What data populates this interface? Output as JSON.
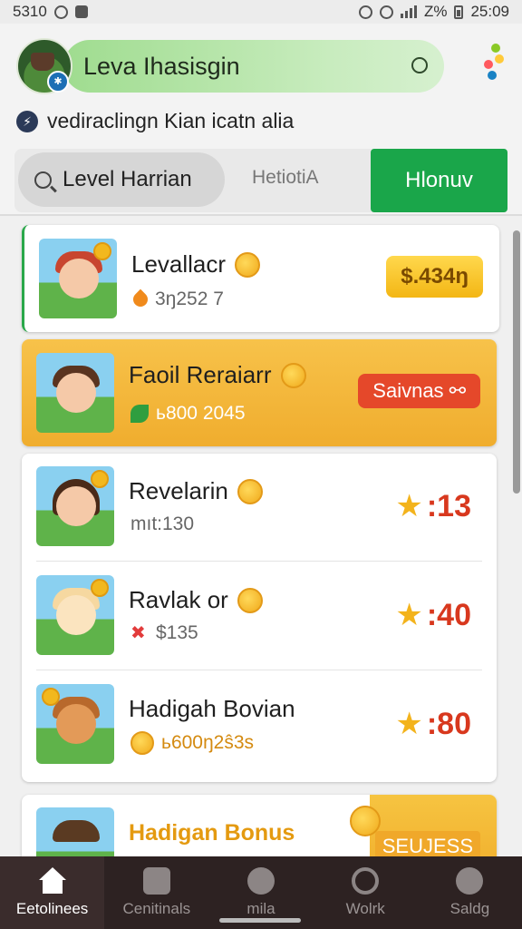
{
  "status_bar": {
    "left_text": "5310",
    "right_text": "Z%",
    "time": "25:09"
  },
  "header": {
    "title": "Leva Ihasisgin",
    "subtitle": "vediraclingn Kian icatn alia"
  },
  "tabs": {
    "search_label": "Level Harrian",
    "middle_label": "HetiotiA",
    "active_label": "Hlonuv"
  },
  "cards": [
    {
      "name": "Levallacr",
      "sub": "3ŋ252 7",
      "price": "$.434ŋ",
      "accent": "#f3b614"
    },
    {
      "name": "Faoil Reraiarr",
      "sub": "ь800 2045",
      "price": "Saivnas",
      "accent": "#e5482a"
    }
  ],
  "list_items": [
    {
      "name": "Revelarin",
      "sub": "mıt:130",
      "score": ":13"
    },
    {
      "name": "Ravlak or",
      "sub": "$135",
      "score": ":40"
    },
    {
      "name": "Hadigah Bovian",
      "sub": "ь600ŋ2ŝ3s",
      "score": ":80"
    }
  ],
  "bonus": {
    "title": "Hadigan Bonus",
    "button": "SEUJESS"
  },
  "bottom_nav": [
    {
      "label": "Eetolinees",
      "icon": "home-icon"
    },
    {
      "label": "Cenitinals",
      "icon": "bag-icon"
    },
    {
      "label": "mila",
      "icon": "moon-icon"
    },
    {
      "label": "Wolrk",
      "icon": "search-icon"
    },
    {
      "label": "Saldg",
      "icon": "profile-icon"
    }
  ],
  "colors": {
    "brand_green": "#1aa64a",
    "highlight_orange": "#f0ad2e",
    "score_red": "#d8381e"
  }
}
